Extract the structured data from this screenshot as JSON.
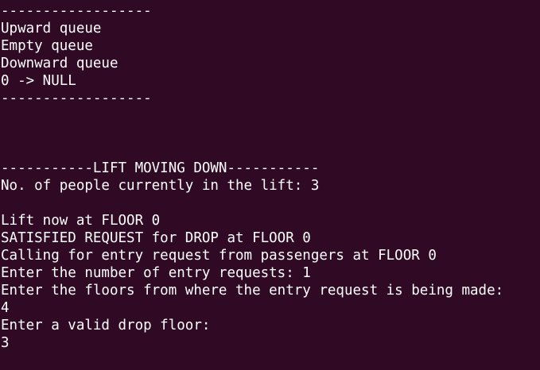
{
  "terminal": {
    "background": "#300a24",
    "foreground": "#ffffff",
    "lines": [
      "------------------",
      "Upward queue",
      "Empty queue",
      "Downward queue",
      "0 -> NULL",
      "------------------",
      "",
      "",
      "",
      "-----------LIFT MOVING DOWN-----------",
      "No. of people currently in the lift: 3",
      "",
      "Lift now at FLOOR 0",
      "SATISFIED REQUEST for DROP at FLOOR 0",
      "Calling for entry request from passengers at FLOOR 0",
      "Enter the number of entry requests: 1",
      "Enter the floors from where the entry request is being made:",
      "4",
      "Enter a valid drop floor:",
      "3"
    ]
  }
}
